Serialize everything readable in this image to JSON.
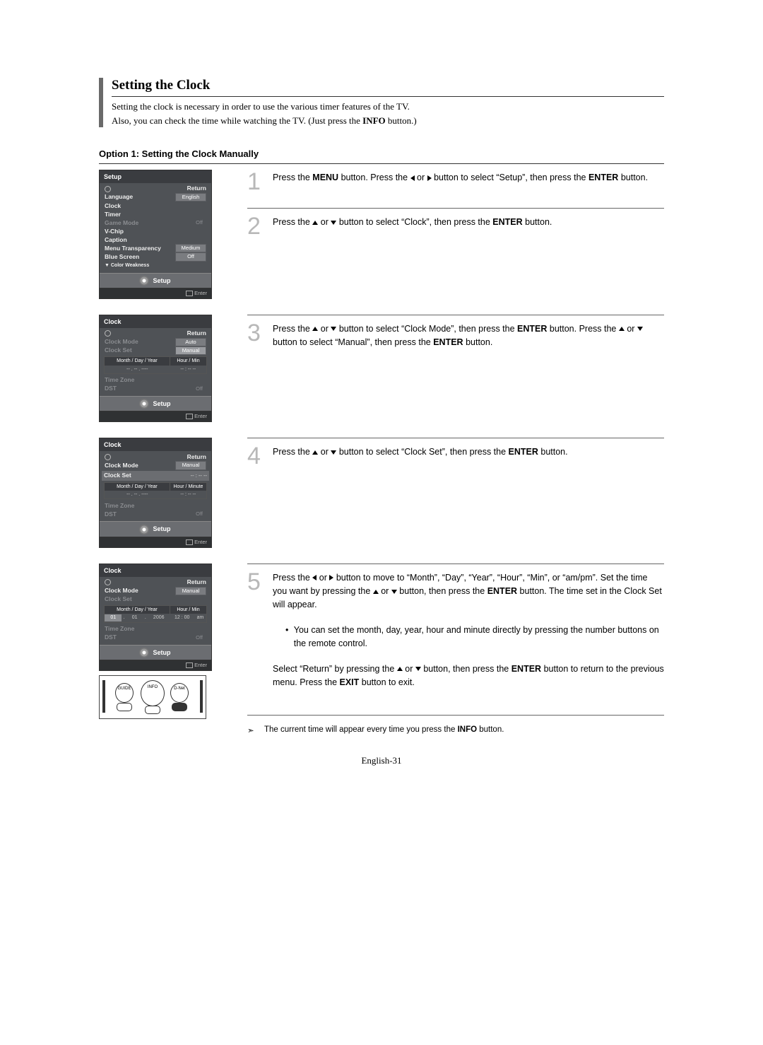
{
  "title": "Setting the Clock",
  "intro_line1": "Setting the clock is necessary in order to use the various timer features of the TV.",
  "intro_line2_a": "Also, you can check the time while watching the TV. (Just press the ",
  "intro_line2_bold": "INFO",
  "intro_line2_b": " button.)",
  "option_heading": "Option 1: Setting the Clock Manually",
  "steps": {
    "s1": {
      "num": "1",
      "a": "Press the ",
      "b": "MENU",
      "c": " button. Press the ",
      "d": " or ",
      "e": " button to select “Setup”, then press the ",
      "f": "ENTER",
      "g": " button."
    },
    "s2": {
      "num": "2",
      "a": "Press the ",
      "b": " or ",
      "c": " button to select “Clock”, then press the ",
      "d": "ENTER",
      "e": " button."
    },
    "s3": {
      "num": "3",
      "a": "Press the ",
      "b": " or ",
      "c": " button to select “Clock Mode”, then press the ",
      "d": "ENTER",
      "e": " button. Press the ",
      "f": " or ",
      "g": " button to select “Manual”, then press the ",
      "h": "ENTER",
      "i": " button."
    },
    "s4": {
      "num": "4",
      "a": "Press the ",
      "b": " or ",
      "c": " button to select “Clock Set”, then press the ",
      "d": "ENTER",
      "e": " button."
    },
    "s5": {
      "num": "5",
      "a": "Press the ",
      "b": " or ",
      "c": " button to move to “Month”, “Day”, “Year”, “Hour”, “Min”, or “am/pm”. Set the time you want by pressing the ",
      "d": " or ",
      "e": " button, then press the ",
      "f": "ENTER",
      "g": " button. The time set in the Clock Set will appear.",
      "bullet": "You can set the month, day, year, hour and minute directly by pressing the number buttons on the remote control.",
      "ret_a": "Select “Return” by pressing the ",
      "ret_b": " or ",
      "ret_c": " button, then press the ",
      "ret_d": "ENTER",
      "ret_e": " button to return to the previous menu. Press the ",
      "ret_f": "EXIT",
      "ret_g": " button to exit.",
      "note_a": "The current time will appear every time you press the ",
      "note_b": "INFO",
      "note_c": " button."
    }
  },
  "osd1": {
    "header": "Setup",
    "return": "Return",
    "items": [
      "Language",
      "Clock",
      "Timer",
      "Game Mode",
      "V-Chip",
      "Caption",
      "Menu Transparency",
      "Blue Screen",
      "▼ Color Weakness"
    ],
    "vals": {
      "Language": "English",
      "Game Mode": "Off",
      "Menu Transparency": "Medium",
      "Blue Screen": "Off"
    },
    "ribbon": "Setup",
    "footer": "Enter"
  },
  "osd2": {
    "header": "Clock",
    "return": "Return",
    "clock_mode": "Clock Mode",
    "clock_mode_vals": [
      "Auto",
      "Manual"
    ],
    "clock_set": "Clock Set",
    "col1": "Month / Day / Year",
    "col2": "Hour / Min",
    "vrow1": "--  .  --  .  ----",
    "vrow2": "-- : --   --",
    "time_zone": "Time Zone",
    "dst": "DST",
    "dst_val": "Off",
    "ribbon": "Setup",
    "footer": "Enter"
  },
  "osd3": {
    "header": "Clock",
    "return": "Return",
    "clock_mode": "Clock Mode",
    "clock_mode_val": "Manual",
    "clock_set": "Clock Set",
    "clock_set_val": "-- : -- --",
    "col1": "Month / Day / Year",
    "col2": "Hour / Minute",
    "vrow1": "--  .  --  .  ----",
    "vrow2": "-- : --   --",
    "time_zone": "Time Zone",
    "dst": "DST",
    "dst_val": "Off",
    "ribbon": "Setup",
    "footer": "Enter"
  },
  "osd4": {
    "header": "Clock",
    "return": "Return",
    "clock_mode": "Clock Mode",
    "clock_mode_val": "Manual",
    "clock_set": "Clock Set",
    "col1": "Month / Day / Year",
    "col2": "Hour / Min",
    "vrow1a": "01",
    "vrow1b": "01",
    "vrow1c": "2006",
    "vrow2a": "12 : 00",
    "vrow2b": "am",
    "time_zone": "Time Zone",
    "dst": "DST",
    "dst_val": "Off",
    "ribbon": "Setup",
    "footer": "Enter"
  },
  "remote": {
    "b1": "GUIDE",
    "b2": "INFO",
    "b3": "D-Net"
  },
  "page_footer": "English-31"
}
